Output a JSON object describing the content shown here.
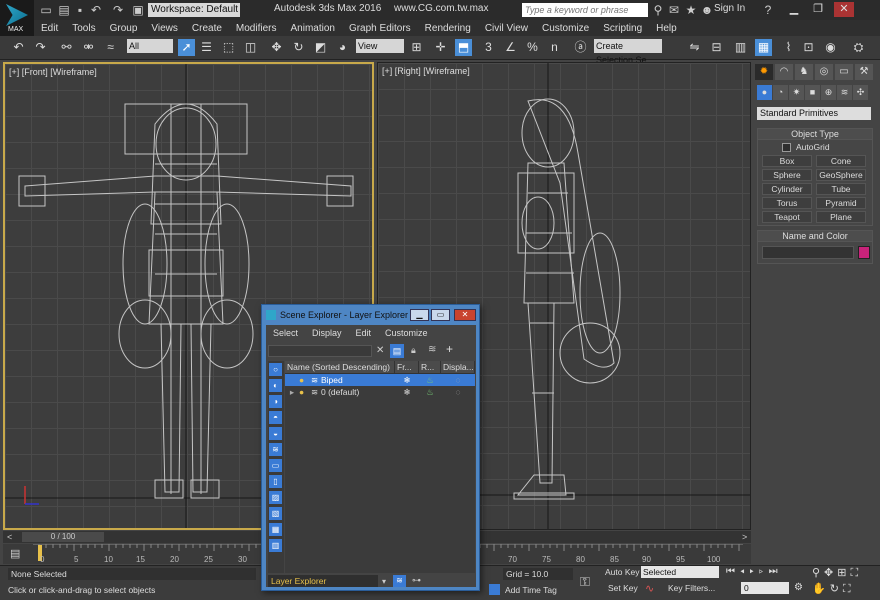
{
  "app": {
    "logo_text": "MAX",
    "workspace": "Workspace: Default",
    "title": "Autodesk 3ds Max 2016",
    "site": "www.CG.com.tw.max",
    "search_placeholder": "Type a keyword or phrase",
    "sign_in": "Sign In"
  },
  "menu": [
    "Edit",
    "Tools",
    "Group",
    "Views",
    "Create",
    "Modifiers",
    "Animation",
    "Graph Editors",
    "Rendering",
    "Civil View",
    "Customize",
    "Scripting",
    "Help"
  ],
  "toolbar": {
    "filter_value": "All",
    "ref_coord": "View",
    "selection_set": "Create Selection Se",
    "snap_label": "3",
    "angle_label": "n"
  },
  "viewports": {
    "front_label": "[+] [Front] [Wireframe]",
    "right_label": "[+] [Right] [Wireframe]"
  },
  "command_panel": {
    "category": "Standard Primitives",
    "object_type_header": "Object Type",
    "autogrid": "AutoGrid",
    "primitives": [
      "Box",
      "Cone",
      "Sphere",
      "GeoSphere",
      "Cylinder",
      "Tube",
      "Torus",
      "Pyramid",
      "Teapot",
      "Plane"
    ],
    "name_color_header": "Name and Color",
    "object_color": "#c8237a"
  },
  "timeline": {
    "slider": "0 / 100",
    "ticks": [
      "0",
      "5",
      "10",
      "15",
      "20",
      "25",
      "30",
      "70",
      "75",
      "80",
      "85",
      "90",
      "95",
      "100"
    ]
  },
  "status": {
    "selection": "None Selected",
    "hint": "Click or click-and-drag to select objects",
    "grid": "Grid = 10.0",
    "add_time_tag": "Add Time Tag",
    "auto_key": "Auto Key",
    "set_key": "Set Key",
    "selected_dropdown": "Selected",
    "key_filters": "Key Filters...",
    "frame": "0"
  },
  "scene_explorer": {
    "title": "Scene Explorer - Layer Explorer",
    "menu": [
      "Select",
      "Display",
      "Edit",
      "Customize"
    ],
    "columns": [
      "Name (Sorted Descending)",
      "Fr...",
      "R...",
      "Displa..."
    ],
    "rows": [
      {
        "name": "Biped",
        "selected": true
      },
      {
        "name": "0 (default)",
        "selected": false
      }
    ],
    "footer_mode": "Layer Explorer"
  },
  "accent_color": "#3a7bd5"
}
